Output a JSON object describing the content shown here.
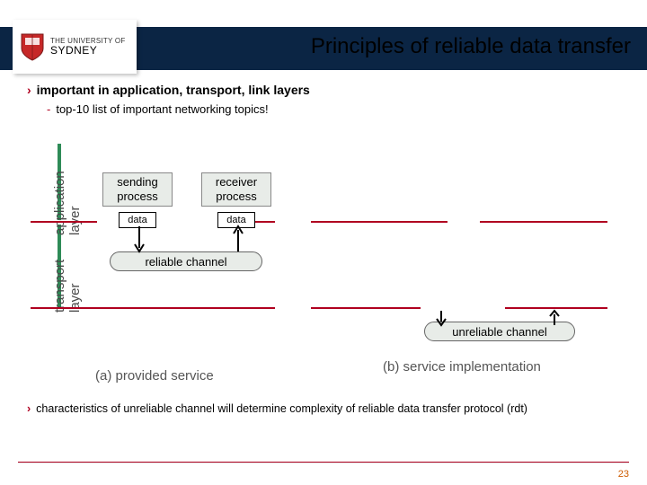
{
  "logo": {
    "top": "THE UNIVERSITY OF",
    "bottom": "SYDNEY"
  },
  "title": "Principles of reliable data transfer",
  "bullets": {
    "b1": "important in application, transport, link layers",
    "s1": "top-10 list of important networking topics!",
    "b2": "characteristics of unreliable channel will determine complexity of reliable data transfer protocol (rdt)"
  },
  "diagram": {
    "layer_app": "application\nlayer",
    "layer_trans": "transport\nlayer",
    "sending": "sending\nprocess",
    "receiver": "receiver\nprocess",
    "data": "data",
    "reliable": "reliable channel",
    "unreliable": "unreliable channel",
    "cap_a": "(a) provided service",
    "cap_b": "(b) service implementation"
  },
  "page": "23"
}
